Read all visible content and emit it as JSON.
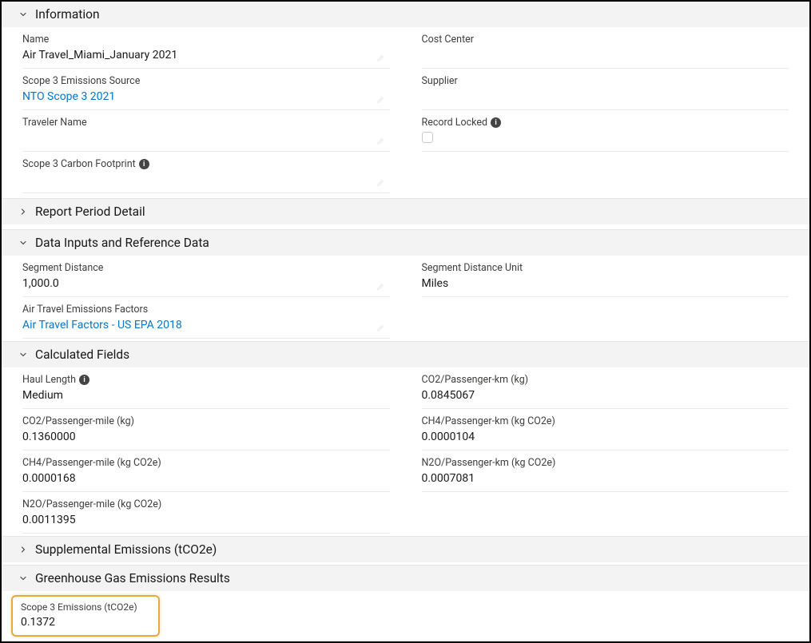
{
  "sections": {
    "information": {
      "title": "Information",
      "expanded": true
    },
    "report_period": {
      "title": "Report Period Detail",
      "expanded": false
    },
    "data_inputs": {
      "title": "Data Inputs and Reference Data",
      "expanded": true
    },
    "calculated": {
      "title": "Calculated Fields",
      "expanded": true
    },
    "supplemental": {
      "title": "Supplemental Emissions (tCO2e)",
      "expanded": false
    },
    "ghg_results": {
      "title": "Greenhouse Gas Emissions Results",
      "expanded": true
    }
  },
  "information": {
    "name": {
      "label": "Name",
      "value": "Air Travel_Miami_January 2021"
    },
    "cost_center": {
      "label": "Cost Center",
      "value": ""
    },
    "scope3_src": {
      "label": "Scope 3 Emissions Source",
      "value": "NTO Scope 3 2021"
    },
    "supplier": {
      "label": "Supplier",
      "value": ""
    },
    "traveler": {
      "label": "Traveler Name",
      "value": ""
    },
    "record_locked": {
      "label": "Record Locked",
      "checked": false
    },
    "carbon_footprint": {
      "label": "Scope 3 Carbon Footprint",
      "value": ""
    }
  },
  "data_inputs": {
    "segment_distance": {
      "label": "Segment Distance",
      "value": "1,000.0"
    },
    "segment_distance_unit": {
      "label": "Segment Distance Unit",
      "value": "Miles"
    },
    "emissions_factors": {
      "label": "Air Travel Emissions Factors",
      "value": "Air Travel Factors - US EPA 2018"
    }
  },
  "calculated": {
    "haul_length": {
      "label": "Haul Length",
      "value": "Medium"
    },
    "co2_km": {
      "label": "CO2/Passenger-km (kg)",
      "value": "0.0845067"
    },
    "co2_mile": {
      "label": "CO2/Passenger-mile (kg)",
      "value": "0.1360000"
    },
    "ch4_km": {
      "label": "CH4/Passenger-km (kg CO2e)",
      "value": "0.0000104"
    },
    "ch4_mile": {
      "label": "CH4/Passenger-mile (kg CO2e)",
      "value": "0.0000168"
    },
    "n2o_km": {
      "label": "N2O/Passenger-km (kg CO2e)",
      "value": "0.0007081"
    },
    "n2o_mile": {
      "label": "N2O/Passenger-mile (kg CO2e)",
      "value": "0.0011395"
    }
  },
  "ghg_results": {
    "scope3_emissions": {
      "label": "Scope 3 Emissions (tCO2e)",
      "value": "0.1372"
    }
  }
}
